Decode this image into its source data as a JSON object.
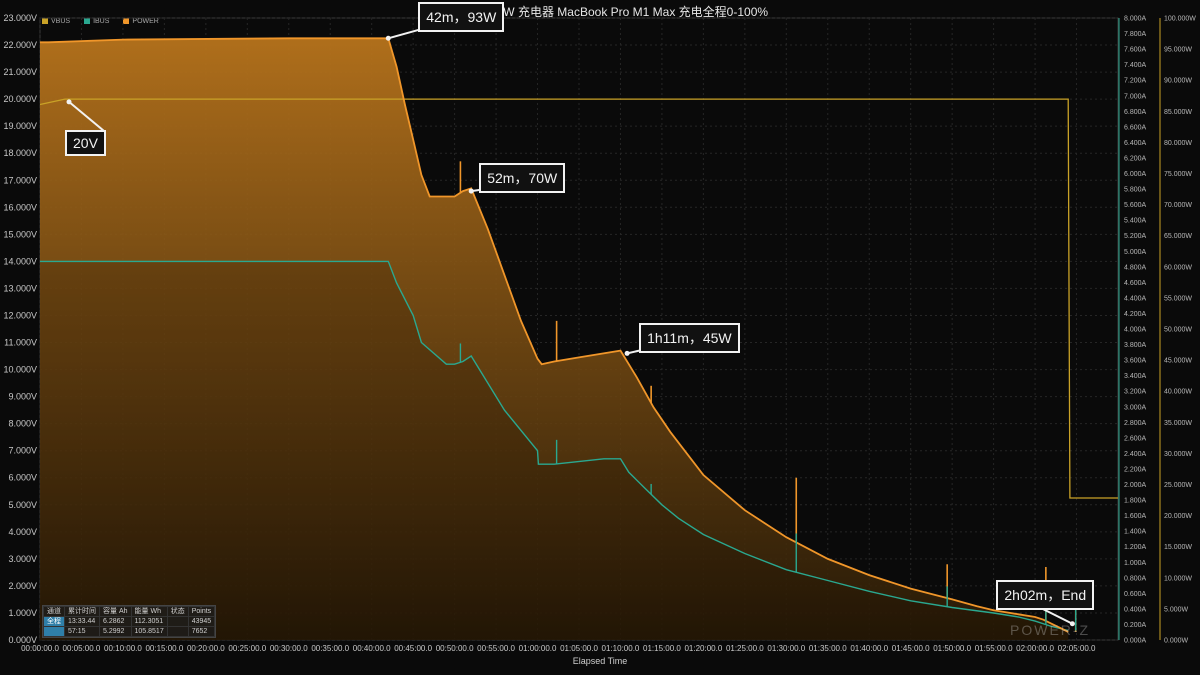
{
  "chart_data": {
    "type": "area",
    "title": "机械革命 100W 充电器 MacBook Pro M1 Max 充电全程0-100%",
    "xlabel": "Elapsed Time",
    "ylabel": "",
    "x_unit": "minutes",
    "xlim": [
      0,
      130
    ],
    "ylim": [
      0,
      23
    ],
    "x_ticks": [
      "00:00:00.0",
      "00:05:00.0",
      "00:10:00.0",
      "00:15:00.0",
      "00:20:00.0",
      "00:25:00.0",
      "00:30:00.0",
      "00:35:00.0",
      "00:40:00.0",
      "00:45:00.0",
      "00:50:00.0",
      "00:55:00.0",
      "01:00:00.0",
      "01:05:00.0",
      "01:10:00.0",
      "01:15:00.0",
      "01:20:00.0",
      "01:25:00.0",
      "01:30:00.0",
      "01:35:00.0",
      "01:40:00.0",
      "01:45:00.0",
      "01:50:00.0",
      "01:55:00.0",
      "02:00:00.0",
      "02:05:00.0"
    ],
    "y_ticks": [
      "0.000V",
      "1.000V",
      "2.000V",
      "3.000V",
      "4.000V",
      "5.000V",
      "6.000V",
      "7.000V",
      "8.000V",
      "9.000V",
      "10.000V",
      "11.000V",
      "12.000V",
      "13.000V",
      "14.000V",
      "15.000V",
      "16.000V",
      "17.000V",
      "18.000V",
      "19.000V",
      "20.000V",
      "21.000V",
      "22.000V",
      "23.000V"
    ],
    "y2_ticks": [
      "0.000A",
      "0.200A",
      "0.400A",
      "0.600A",
      "0.800A",
      "1.000A",
      "1.200A",
      "1.400A",
      "1.600A",
      "1.800A",
      "2.000A",
      "2.200A",
      "2.400A",
      "2.600A",
      "2.800A",
      "3.000A",
      "3.200A",
      "3.400A",
      "3.600A",
      "3.800A",
      "4.000A",
      "4.200A",
      "4.400A",
      "4.600A",
      "4.800A",
      "5.000A",
      "5.200A",
      "5.400A",
      "5.600A",
      "5.800A",
      "6.000A",
      "6.200A",
      "6.400A",
      "6.600A",
      "6.800A",
      "7.000A",
      "7.200A",
      "7.400A",
      "7.600A",
      "7.800A",
      "8.000A"
    ],
    "y3_ticks": [
      "0.000W",
      "5.000W",
      "10.000W",
      "15.000W",
      "20.000W",
      "25.000W",
      "30.000W",
      "35.000W",
      "40.000W",
      "45.000W",
      "50.000W",
      "55.000W",
      "60.000W",
      "65.000W",
      "70.000W",
      "75.000W",
      "80.000W",
      "85.000W",
      "90.000W",
      "95.000W",
      "100.000W"
    ],
    "series": [
      {
        "name": "VBUS",
        "color": "#c9a227",
        "x": [
          0,
          3,
          40,
          124,
          124.2,
          130
        ],
        "y": [
          19.8,
          20.0,
          20.0,
          20.0,
          5.25,
          5.25
        ]
      },
      {
        "name": "IBUS",
        "color": "#2aa890",
        "x": [
          0,
          42,
          43,
          45,
          46,
          49,
          50,
          51,
          52,
          56,
          60,
          60.1,
          62,
          68,
          70,
          71,
          73,
          75,
          77,
          80,
          85,
          90,
          95,
          100,
          105,
          110,
          115,
          118,
          120,
          122,
          124
        ],
        "y": [
          14.0,
          14.0,
          13.2,
          12.0,
          11.0,
          10.2,
          10.2,
          10.3,
          10.5,
          8.5,
          7.0,
          6.5,
          6.5,
          6.7,
          6.7,
          6.2,
          5.6,
          5.0,
          4.5,
          3.9,
          3.2,
          2.6,
          2.2,
          1.8,
          1.45,
          1.2,
          1.0,
          0.85,
          0.7,
          0.5,
          0.35
        ]
      },
      {
        "name": "POWER",
        "color": "#f0962a",
        "x": [
          0,
          1,
          10,
          30,
          42,
          43,
          44,
          45,
          46,
          47,
          50,
          51,
          52,
          54,
          56,
          58,
          60,
          60.5,
          62,
          65,
          70,
          71,
          72,
          74,
          76,
          78,
          80,
          85,
          90,
          95,
          100,
          105,
          110,
          113,
          115,
          118,
          120,
          121,
          122,
          123,
          124
        ],
        "y": [
          22.1,
          22.1,
          22.2,
          22.25,
          22.25,
          21.2,
          19.8,
          18.5,
          17.2,
          16.4,
          16.4,
          16.6,
          16.7,
          15.2,
          13.5,
          11.8,
          10.4,
          10.2,
          10.3,
          10.45,
          10.7,
          10.2,
          9.7,
          8.6,
          7.7,
          6.9,
          6.1,
          4.8,
          3.8,
          3.0,
          2.4,
          1.9,
          1.5,
          1.25,
          1.1,
          0.95,
          0.85,
          0.75,
          0.6,
          0.45,
          0.3
        ]
      }
    ],
    "spikes": [
      {
        "x": 50.7,
        "y": 17.7
      },
      {
        "x": 62.3,
        "y": 11.8
      },
      {
        "x": 73.7,
        "y": 9.4
      },
      {
        "x": 91.2,
        "y": 6.0
      },
      {
        "x": 109.4,
        "y": 2.8
      },
      {
        "x": 121.3,
        "y": 2.7
      },
      {
        "x": 124.9,
        "y": 1.6
      }
    ],
    "annotations": [
      {
        "text": "42m，93W",
        "x": 42,
        "y": 22.25
      },
      {
        "text": "20V",
        "x": 3.5,
        "y": 19.9
      },
      {
        "text": "52m，70W",
        "x": 52,
        "y": 16.6
      },
      {
        "text": "1h11m，45W",
        "x": 70.8,
        "y": 10.6
      },
      {
        "text": "2h02m，End",
        "x": 124.5,
        "y": 0.6
      }
    ],
    "legend": {
      "placement": "top-left"
    },
    "grid": true
  },
  "legend_items": [
    {
      "label": "VBUS",
      "color": "#c9a227"
    },
    {
      "label": "IBUS",
      "color": "#2aa890"
    },
    {
      "label": "POWER",
      "color": "#f0962a"
    }
  ],
  "stats_table": {
    "headers": [
      "通道",
      "累计时间",
      "容量 Ah",
      "能量 Wh",
      "状态",
      "Points"
    ],
    "rows": [
      [
        "全程",
        "13:33.44",
        "6.2862",
        "112.3051",
        "",
        "43945"
      ],
      [
        "",
        "57:15",
        "5.2992",
        "105.8517",
        "",
        "7652"
      ]
    ]
  },
  "watermark": "POWER-Z"
}
